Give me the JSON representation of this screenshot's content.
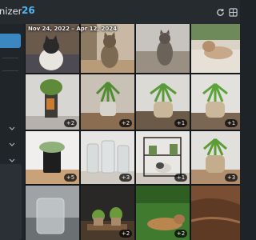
{
  "app": {
    "title_fragment": "anizer",
    "count": "26"
  },
  "gallery": {
    "date_range": "Nov 24, 2022 – Apr 12, 2024",
    "photos": [
      {
        "subject": "cat on rug",
        "badge": ""
      },
      {
        "subject": "tabby cat sitting by door",
        "badge": ""
      },
      {
        "subject": "tabby cat on floor",
        "badge": ""
      },
      {
        "subject": "cat lounging on couch",
        "badge": ""
      },
      {
        "subject": "metal lantern plant",
        "badge": "+2"
      },
      {
        "subject": "potted plant on floor",
        "badge": "+2"
      },
      {
        "subject": "potted plant on table",
        "badge": "+1"
      },
      {
        "subject": "potted plant on table",
        "badge": "+1"
      },
      {
        "subject": "succulent in black pot",
        "badge": "+5"
      },
      {
        "subject": "glass jars",
        "badge": "+3"
      },
      {
        "subject": "shelf with cat",
        "badge": "+1"
      },
      {
        "subject": "plant in wicker basket",
        "badge": "+3"
      },
      {
        "subject": "glass vessel",
        "badge": ""
      },
      {
        "subject": "plants on wooden tray",
        "badge": "+2"
      },
      {
        "subject": "cat lying in garden",
        "badge": "+2"
      },
      {
        "subject": "wooden texture",
        "badge": ""
      }
    ]
  },
  "colors": {
    "accent": "#3a87c2",
    "count_color": "#52b6f0",
    "background": "#1e2328"
  },
  "icons": [
    "refresh-icon",
    "grid-view-icon",
    "chevron-down-icon"
  ]
}
